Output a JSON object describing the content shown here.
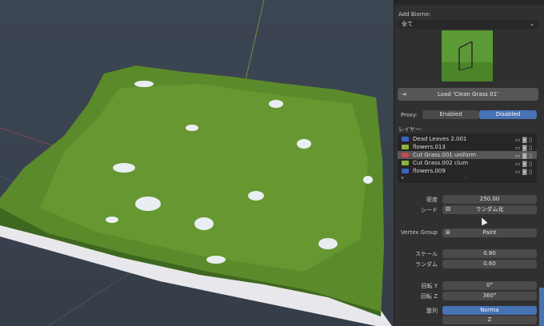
{
  "panel": {
    "add_biome_label": "Add Biome:",
    "biome_select_value": "全て",
    "load_button_label": "Load 'Clean Grass 01'",
    "proxy_label": "Proxy:",
    "proxy_enabled_label": "Enabled",
    "proxy_disabled_label": "Disabled",
    "layers_label": "レイヤー:",
    "layers": [
      {
        "name": "Dead Leaves 2.001",
        "color": "#3d63c4",
        "selected": false
      },
      {
        "name": "flowers.013",
        "color": "#8bb43a",
        "selected": false
      },
      {
        "name": "Cut Grass.001 uniform",
        "color": "#c24a4a",
        "selected": true
      },
      {
        "name": "Cut Grass.002 clum",
        "color": "#8bb43a",
        "selected": false
      },
      {
        "name": "flowers.009",
        "color": "#3d63c4",
        "selected": false
      }
    ],
    "density_label": "密度",
    "density_value": "250.00",
    "seed_label": "シード",
    "seed_button": "ランダム化",
    "vertex_group_label": "Vertex Group",
    "vertex_group_value": "Paint",
    "scale_label": "スケール",
    "scale_value": "0.80",
    "random_label": "ランダム",
    "random_value": "0.60",
    "rot_x_label": "回転 Y",
    "rot_x_value": "0°",
    "rot_z_label": "回転 Z",
    "rot_z_value": "360°",
    "align_label": "整列",
    "align_normal": "Norma",
    "align_z": "Z"
  },
  "icons": {
    "load_icon": "arrow-in-icon",
    "seed_icon": "dice-icon",
    "vertex_icon": "vertex-group-icon",
    "layer_icons": "screen-camera-trash"
  },
  "colors": {
    "accent": "#4772b3",
    "panel_bg": "#303030",
    "grass": "#5d8a2c"
  }
}
